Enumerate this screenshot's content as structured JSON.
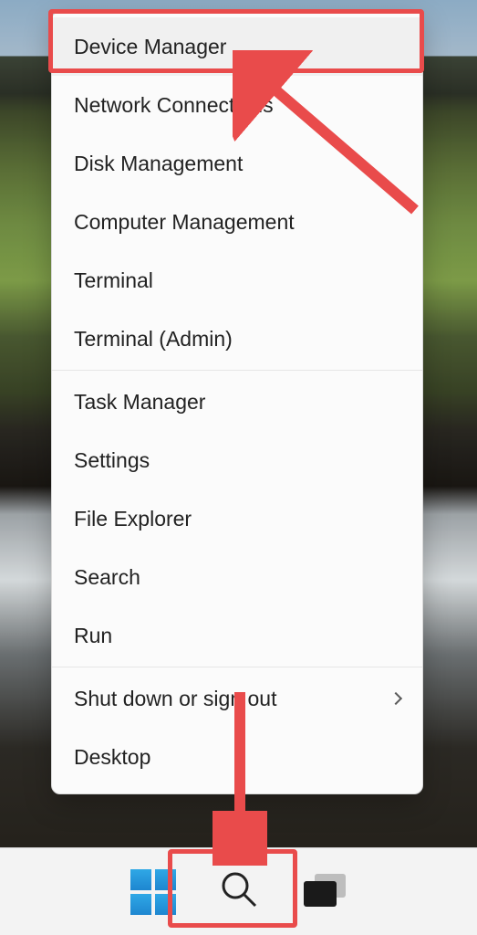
{
  "menu": {
    "groups": [
      [
        {
          "label": "Device Manager",
          "highlighted": true
        },
        {
          "label": "Network Connections"
        },
        {
          "label": "Disk Management"
        },
        {
          "label": "Computer Management"
        },
        {
          "label": "Terminal"
        },
        {
          "label": "Terminal (Admin)"
        }
      ],
      [
        {
          "label": "Task Manager"
        },
        {
          "label": "Settings"
        },
        {
          "label": "File Explorer"
        },
        {
          "label": "Search"
        },
        {
          "label": "Run"
        }
      ],
      [
        {
          "label": "Shut down or sign out",
          "submenu": true
        },
        {
          "label": "Desktop"
        }
      ]
    ]
  },
  "taskbar": {
    "buttons": {
      "start": "Start",
      "search": "Search",
      "taskview": "Task View"
    }
  },
  "annotations": {
    "highlight_color": "#e94b4b"
  }
}
